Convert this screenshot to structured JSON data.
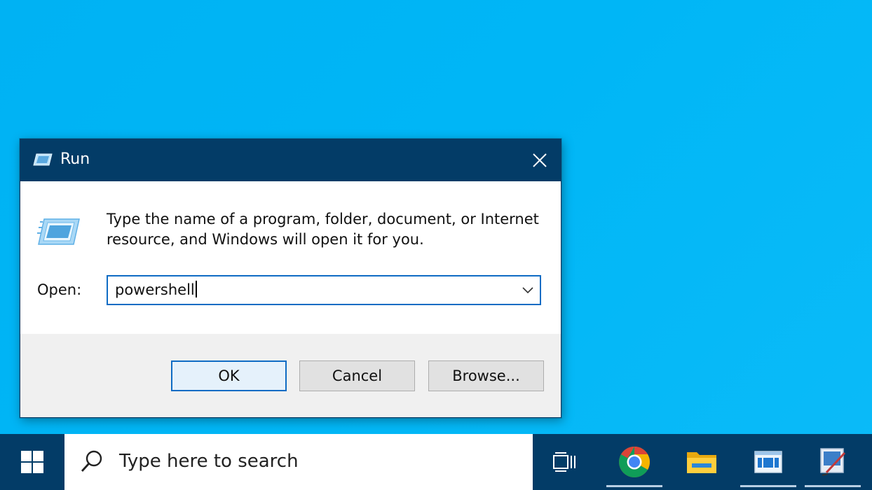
{
  "dialog": {
    "title": "Run",
    "close_label": "×",
    "description": "Type the name of a program, folder, document, or Internet resource, and Windows will open it for you.",
    "open_label": "Open:",
    "open_value": "powershell",
    "buttons": {
      "ok": "OK",
      "cancel": "Cancel",
      "browse": "Browse..."
    }
  },
  "taskbar": {
    "search_placeholder": "Type here to search",
    "icons": [
      "windows-start-icon",
      "search-icon",
      "task-view-icon",
      "chrome-icon",
      "file-explorer-icon",
      "app-window-icon",
      "paint-icon"
    ]
  },
  "colors": {
    "desktop": "#00b6f6",
    "titlebar": "#033c67",
    "accent": "#0f6cc4",
    "taskbar": "#033c67"
  }
}
